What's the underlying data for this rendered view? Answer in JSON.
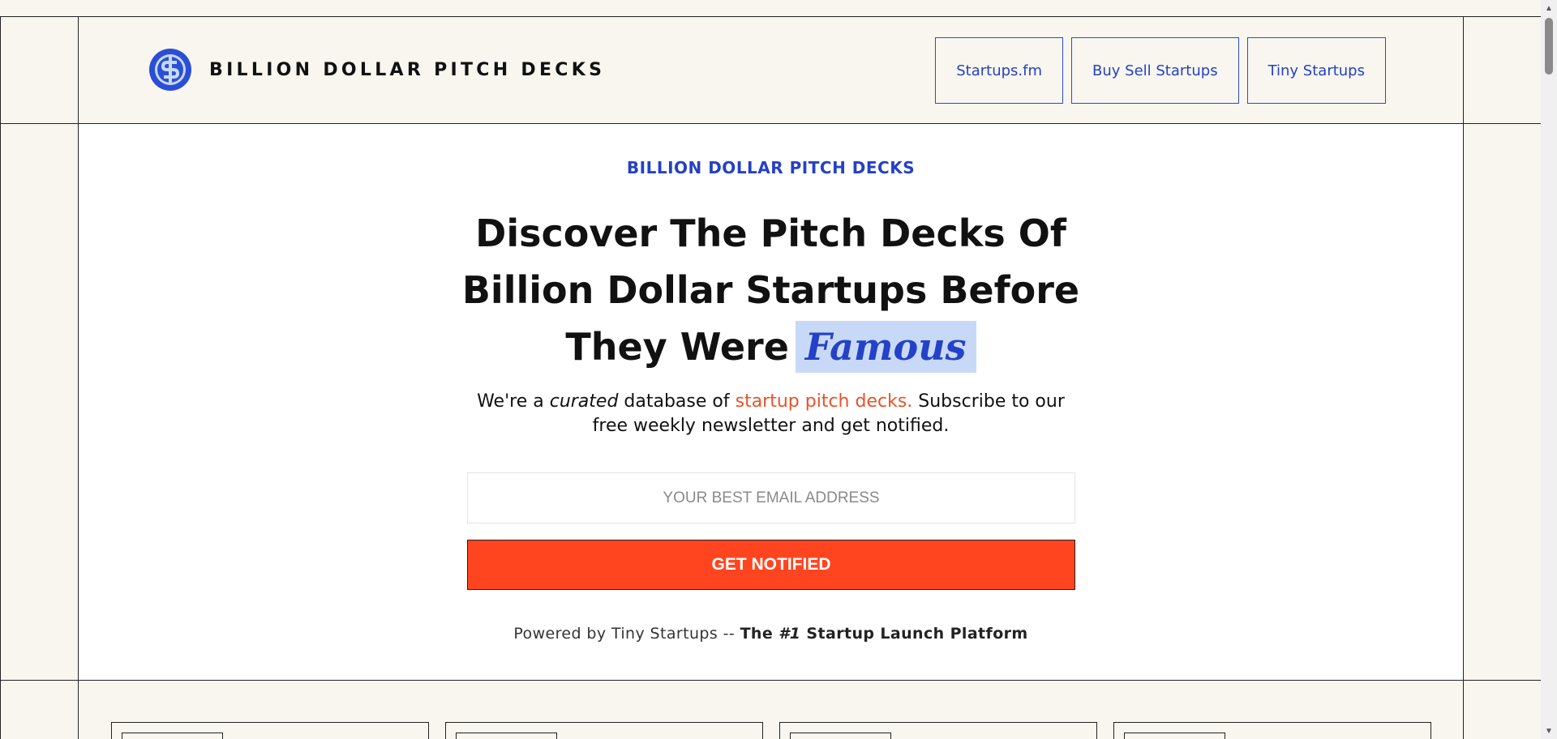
{
  "header": {
    "brand": "BILLION DOLLAR PITCH DECKS",
    "logo_icon": "dollar-coin-icon",
    "nav": [
      "Startups.fm",
      "Buy Sell Startups",
      "Tiny Startups"
    ]
  },
  "hero": {
    "eyebrow": "BILLION DOLLAR PITCH DECKS",
    "headline_line1": "Discover The Pitch Decks Of",
    "headline_line2": "Billion Dollar Startups Before",
    "headline_line3": "They Were",
    "headline_highlight": "Famous",
    "sub_part1": "We're a ",
    "sub_italic": "curated",
    "sub_part2": " database of ",
    "sub_accent": "startup pitch decks.",
    "sub_part3": " Subscribe to our",
    "sub_line2": "free weekly newsletter and get notified.",
    "email_placeholder": "YOUR BEST EMAIL ADDRESS",
    "cta_label": "GET NOTIFIED",
    "powered_prefix": "Powered by Tiny Startups -- ",
    "powered_bold_1": "The ",
    "powered_bold_italic": "#1",
    "powered_bold_2": " Startup Launch Platform"
  },
  "colors": {
    "brand_blue": "#2441c7",
    "accent_orange": "#ff4520",
    "highlight_bg": "#c8d9f7",
    "page_bg": "#f8f6ef"
  }
}
